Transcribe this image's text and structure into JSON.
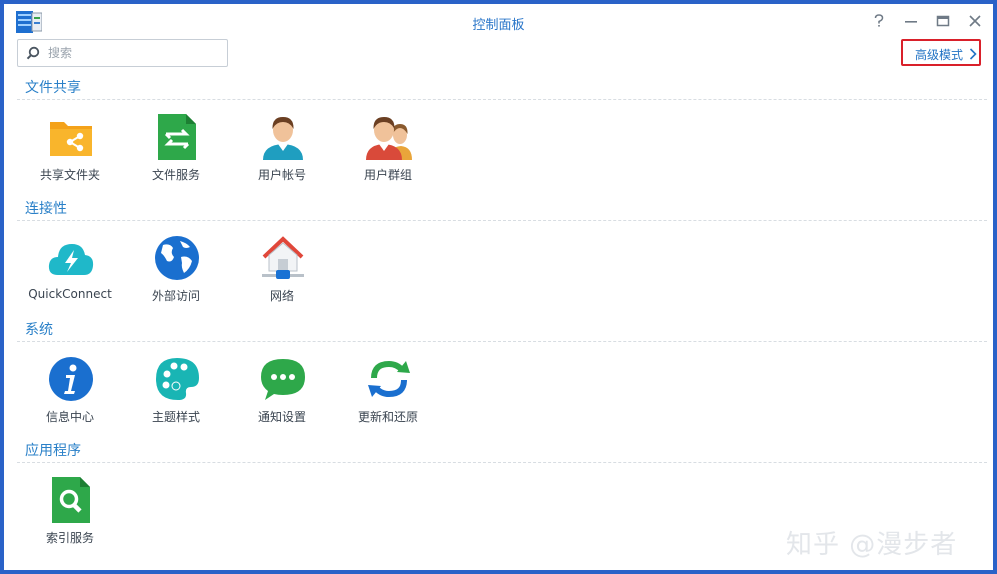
{
  "window": {
    "title": "控制面板"
  },
  "search": {
    "placeholder": "搜索"
  },
  "advanced_mode": {
    "label": "高级模式"
  },
  "sections": [
    {
      "title": "文件共享",
      "items": [
        {
          "label": "共享文件夹",
          "icon": "shared-folder-icon"
        },
        {
          "label": "文件服务",
          "icon": "file-services-icon"
        },
        {
          "label": "用户帐号",
          "icon": "user-icon"
        },
        {
          "label": "用户群组",
          "icon": "group-icon"
        }
      ]
    },
    {
      "title": "连接性",
      "items": [
        {
          "label": "QuickConnect",
          "icon": "cloud-bolt-icon"
        },
        {
          "label": "外部访问",
          "icon": "globe-icon"
        },
        {
          "label": "网络",
          "icon": "house-network-icon"
        }
      ]
    },
    {
      "title": "系统",
      "items": [
        {
          "label": "信息中心",
          "icon": "info-icon"
        },
        {
          "label": "主题样式",
          "icon": "palette-icon"
        },
        {
          "label": "通知设置",
          "icon": "chat-bubble-icon"
        },
        {
          "label": "更新和还原",
          "icon": "refresh-icon"
        }
      ]
    },
    {
      "title": "应用程序",
      "items": [
        {
          "label": "索引服务",
          "icon": "search-document-icon"
        }
      ]
    }
  ],
  "watermark": "知乎 @漫步者",
  "colors": {
    "accent": "#2a76c9",
    "highlight_border": "#d9202a"
  }
}
